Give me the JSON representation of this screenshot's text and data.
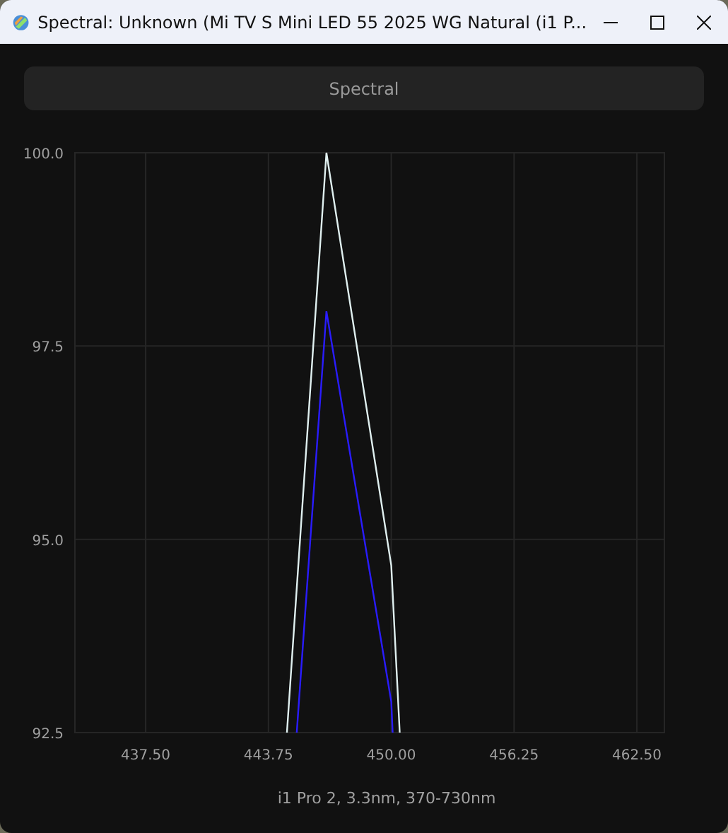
{
  "window": {
    "title": "Spectral: Unknown (Mi TV S Mini LED 55 2025 WG Natural (i1 P..."
  },
  "mode_button": {
    "label": "Spectral"
  },
  "chart_data": {
    "type": "line",
    "grid": true,
    "xlabel": "i1 Pro 2, 3.3nm, 370-730nm",
    "x": [
      444.69,
      445.19,
      446.7,
      450.0,
      450.07,
      450.43
    ],
    "series": [
      {
        "color": "#e0f0f0",
        "values": [
          92.5,
          94.37,
          100.0,
          94.66,
          94.31,
          92.5
        ]
      },
      {
        "color": "#2a1cff",
        "values": [
          null,
          92.5,
          97.95,
          92.9,
          92.5,
          null
        ]
      }
    ],
    "xlim": [
      433.9,
      463.9
    ],
    "ylim": [
      92.5,
      100.0
    ],
    "xticks": [
      {
        "value": 437.5,
        "label": "437.50"
      },
      {
        "value": 443.75,
        "label": "443.75"
      },
      {
        "value": 450,
        "label": "450.00"
      },
      {
        "value": 456.25,
        "label": "456.25"
      },
      {
        "value": 462.5,
        "label": "462.50"
      }
    ],
    "yticks": [
      {
        "value": 92.5,
        "label": "92.5"
      },
      {
        "value": 95,
        "label": "95.0"
      },
      {
        "value": 97.5,
        "label": "97.5"
      },
      {
        "value": 100,
        "label": "100.0"
      }
    ]
  }
}
